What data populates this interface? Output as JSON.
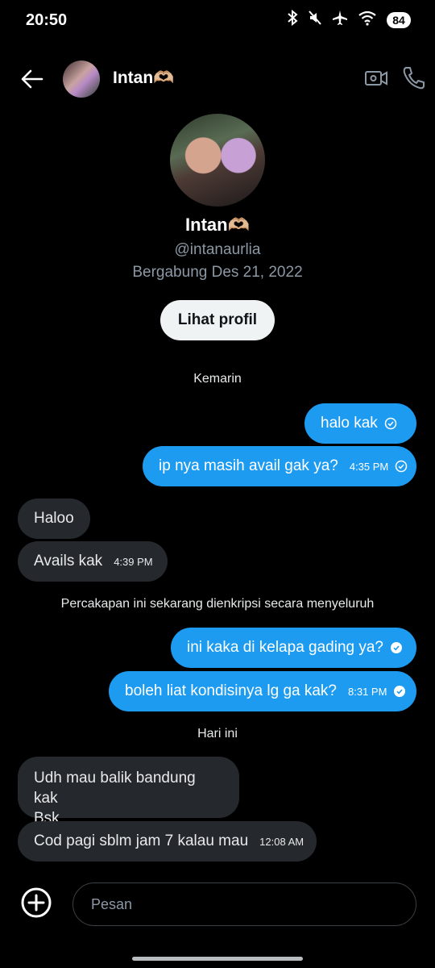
{
  "status": {
    "time": "20:50",
    "battery": "84"
  },
  "header": {
    "name": "Intan🫶🏼"
  },
  "profile": {
    "name": "Intan🫶🏼",
    "handle": "@intanaurlia",
    "joined": "Bergabung Des 21, 2022",
    "view_profile_label": "Lihat profil"
  },
  "dividers": {
    "yesterday": "Kemarin",
    "encrypted": "Percakapan ini sekarang dienkripsi secara menyeluruh",
    "today": "Hari ini"
  },
  "messages": [
    {
      "dir": "out",
      "text": "halo kak",
      "time": ""
    },
    {
      "dir": "out",
      "text": "ip nya masih avail gak ya?",
      "time": "4:35 PM"
    },
    {
      "dir": "in",
      "text": "Haloo",
      "time": ""
    },
    {
      "dir": "in",
      "text": "Avails kak",
      "time": "4:39 PM"
    },
    {
      "dir": "out",
      "text": "ini kaka di kelapa gading ya?",
      "time": ""
    },
    {
      "dir": "out",
      "text": "boleh liat kondisinya lg ga kak?",
      "time": "8:31 PM"
    },
    {
      "dir": "in",
      "text": "Udh mau balik bandung kak Bsk",
      "line1": "Udh mau balik bandung kak",
      "line2": "Bsk",
      "time": ""
    },
    {
      "dir": "in",
      "text": "Cod pagi sblm jam 7 kalau mau",
      "time": "12:08 AM"
    }
  ],
  "compose": {
    "placeholder": "Pesan"
  },
  "colors": {
    "outgoing": "#1d9bf0",
    "incoming": "#25292e",
    "background": "#000000"
  }
}
